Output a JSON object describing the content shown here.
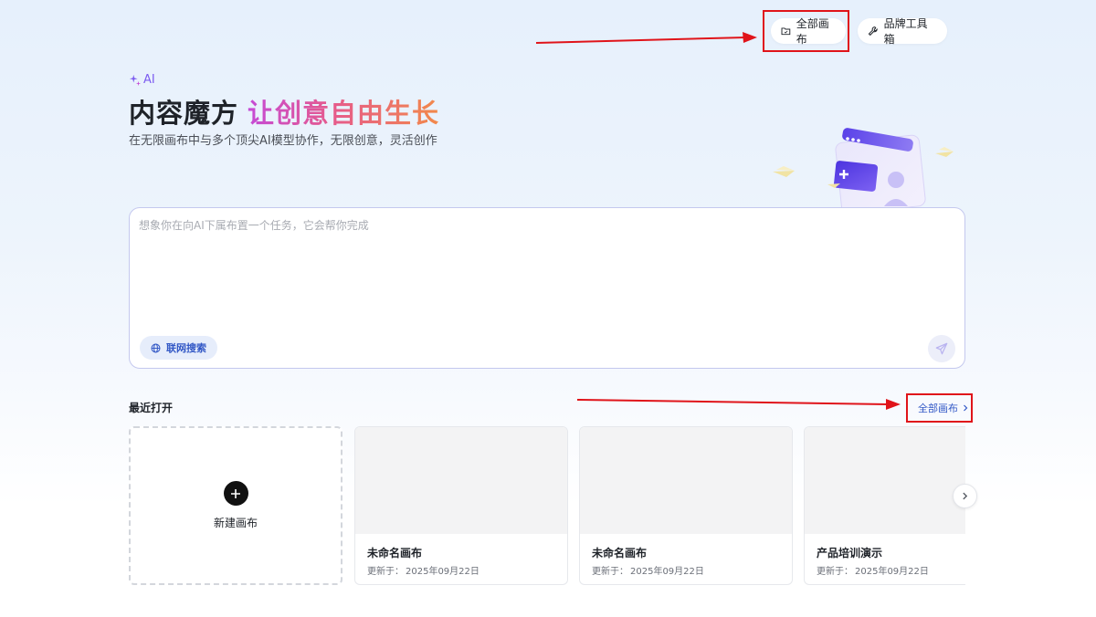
{
  "header": {
    "all_canvas_label": "全部画布",
    "brand_tools_label": "品牌工具箱"
  },
  "hero": {
    "ai_badge": "AI",
    "title_main": "内容魔方",
    "title_accent": "让创意自由生长",
    "subtitle": "在无限画布中与多个顶尖AI模型协作，无限创意，灵活创作"
  },
  "prompt": {
    "placeholder": "想象你在向AI下属布置一个任务，它会帮你完成",
    "value": "",
    "web_search_label": "联网搜索"
  },
  "recent": {
    "title": "最近打开",
    "view_all_label": "全部画布",
    "new_canvas_label": "新建画布",
    "date_prefix": "更新于：",
    "cards": [
      {
        "title": "未命名画布",
        "date": "2025年09月22日"
      },
      {
        "title": "未命名画布",
        "date": "2025年09月22日"
      },
      {
        "title": "产品培训演示",
        "date": "2025年09月22日"
      }
    ]
  },
  "colors": {
    "accent_blue": "#3258c6",
    "annotation_red": "#e0141a",
    "ai_purple": "#7c5cf0",
    "gradient_start": "#c54ad6",
    "gradient_end": "#f2894a"
  },
  "icons": {
    "all_canvas": "folder-icon",
    "brand_tools": "wrench-icon",
    "ai": "sparkle-icon",
    "web_search": "globe-icon",
    "send": "send-icon",
    "new": "plus-icon",
    "next": "chevron-right-icon"
  }
}
